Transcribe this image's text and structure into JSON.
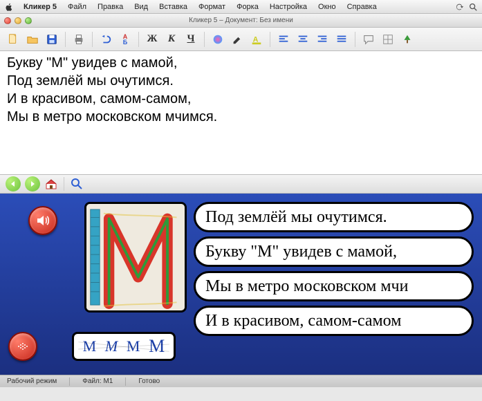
{
  "menubar": {
    "app_name": "Кликер 5",
    "items": [
      "Файл",
      "Правка",
      "Вид",
      "Вставка",
      "Формат",
      "Форка",
      "Настройка",
      "Окно",
      "Справка"
    ]
  },
  "doc_title": "Кликер 5 – Документ: Без имени",
  "toolbar": {
    "bold": "Ж",
    "italic": "К",
    "underline": "Ч"
  },
  "document_lines": [
    "Букву \"М\" увидев с мамой,",
    "Под землёй мы очутимся.",
    "И в красивом, самом-самом,",
    "Мы в метро московском мчимся."
  ],
  "grid": {
    "sentences": [
      "Под землёй мы очутимся.",
      "Букву \"М\" увидев с мамой,",
      "Мы в метро московском мчи",
      "И в красивом, самом-самом"
    ],
    "letter_variants": [
      "М",
      "М",
      "М",
      "М"
    ]
  },
  "statusbar": {
    "mode": "Рабочий режим",
    "file": "Файл: М1",
    "ready": "Готово"
  }
}
